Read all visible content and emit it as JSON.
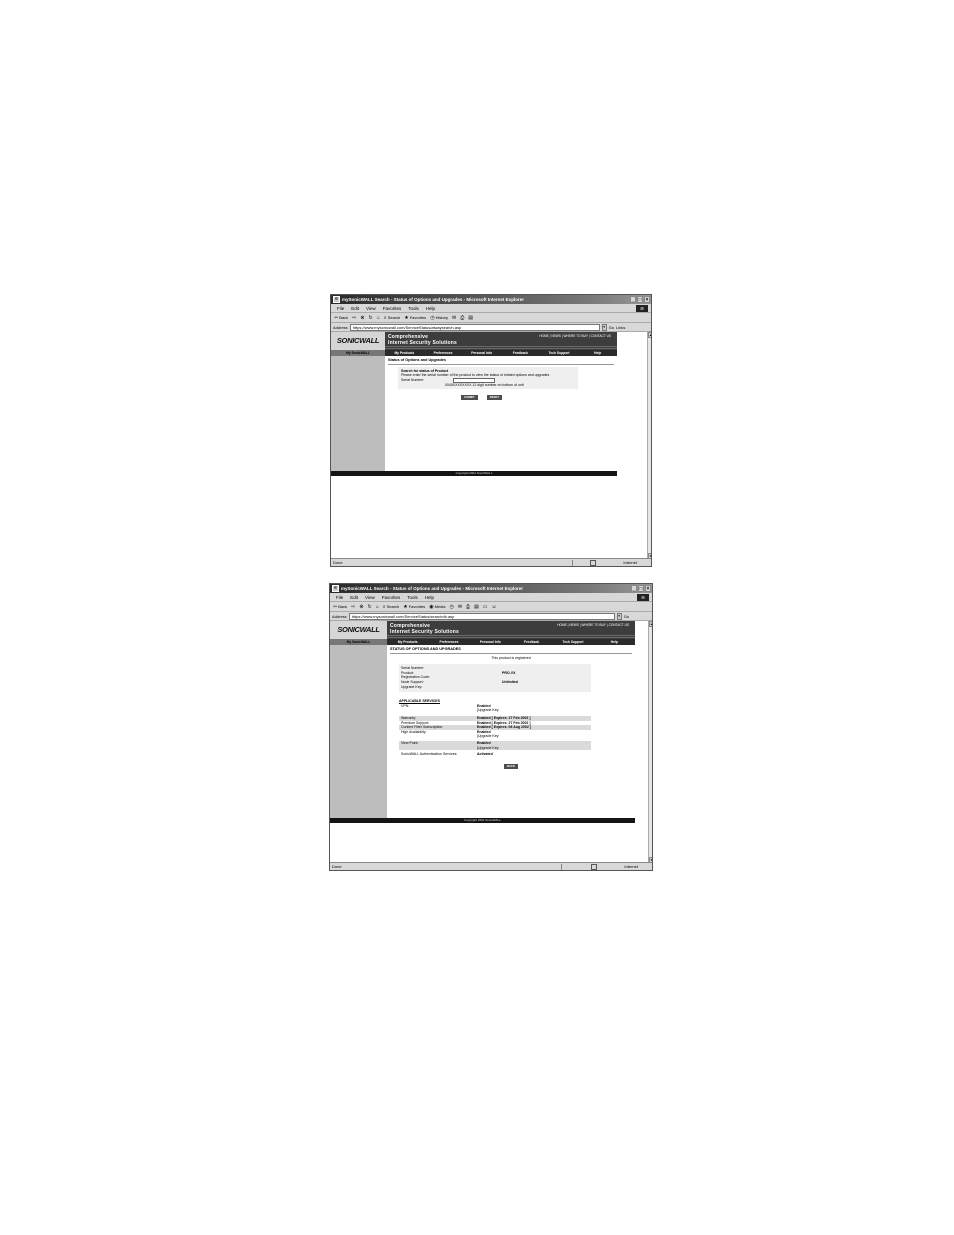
{
  "windows": [
    {
      "title": "mySonicWALL Search - Status of Options and Upgrades - Microsoft Internet Explorer",
      "menu": [
        "File",
        "Edit",
        "View",
        "Favorites",
        "Tools",
        "Help"
      ],
      "toolbar": {
        "back": "Back",
        "search": "Search",
        "favorites": "Favorites",
        "history": "History"
      },
      "address_label": "Address",
      "url": "https://www.mysonicwall.com/ServiceStatus/alwaysearch.asp",
      "go": "Go",
      "links": "Links",
      "status": "Done",
      "zone": "Internet",
      "site": {
        "logo": "SONICWALL",
        "tagline_1": "Comprehensive",
        "tagline_2": "Internet Security Solutions",
        "top_links": "HOME | NEWS | WHERE TO BUY | CONTACT US",
        "nav": [
          "My SonicWALL",
          "My Products",
          "Preferences",
          "Personal Info",
          "Feedback",
          "Tech Support",
          "Help"
        ],
        "page_title": "Status of Options and Upgrades",
        "form_title": "Search for status of Product",
        "form_text": "Please enter the serial number of the product to view the status of related options and upgrades",
        "serial_label": "Serial Number:",
        "serial_hint": "0040XXXXXXXX 12 digit number on bottom of unit",
        "submit": "SUBMIT",
        "reset": "RESET",
        "copyright": "Copyright 2001 SonicWALL"
      }
    },
    {
      "title": "mySonicWALL Search - Status of Options and Upgrades - Microsoft Internet Explorer",
      "menu": [
        "File",
        "Edit",
        "View",
        "Favorites",
        "Tools",
        "Help"
      ],
      "toolbar": {
        "back": "Back",
        "search": "Search",
        "favorites": "Favorites",
        "media": "Media"
      },
      "address_label": "Address",
      "url": "https://www.mysonicwall.com/ServiceStatus/searchdb.asp",
      "go": "Go",
      "status": "Done",
      "zone": "Internet",
      "site": {
        "logo": "SONICWALL",
        "tagline_1": "Comprehensive",
        "tagline_2": "Internet Security Solutions",
        "top_links": "HOME | NEWS | WHERE TO BUY | CONTACT US",
        "nav": [
          "My SonicWALL",
          "My Products",
          "Preferences",
          "Personal Info",
          "Feedback",
          "Tech Support",
          "Help"
        ],
        "page_title": "STATUS OF OPTIONS AND UPGRADES",
        "registered": "This product is registered",
        "product_info": [
          {
            "label": "Serial Number:",
            "value": ""
          },
          {
            "label": "Product:",
            "value": "PRO-VX"
          },
          {
            "label": "Registration Code:",
            "value": ""
          },
          {
            "label": "Node Support:",
            "value": "Unlimited"
          },
          {
            "label": "Upgrade Key:",
            "value": ""
          }
        ],
        "services_title": "APPLICABLE SERVICES",
        "services": [
          {
            "label": "VPN:",
            "status": "Enabled",
            "detail": "",
            "line2": "[Upgrade Key:"
          },
          {
            "label": "Warranty:",
            "status": "Enabled",
            "detail": "[ Expires: 27 Feb 2002 ]",
            "line2": ""
          },
          {
            "label": "Premium Support:",
            "status": "Enabled",
            "detail": "[ Expires: 27 Feb 2002 ]",
            "line2": ""
          },
          {
            "label": "Content Filter Subscription:",
            "status": "Enabled",
            "detail": "[ Expires: 06 Aug 2002 ]",
            "line2": ""
          },
          {
            "label": "High Availability:",
            "status": "Enabled",
            "detail": "",
            "line2": "[Upgrade Key:"
          },
          {
            "label": "View Point:",
            "status": "Enabled",
            "detail": "",
            "line2": "[Upgrade Key:"
          },
          {
            "label": "SonicWALL Authentication Services:",
            "status": "Activated",
            "detail": "",
            "line2": ""
          }
        ],
        "back": "BACK",
        "copyright": "Copyright 2001 SonicWALL"
      }
    }
  ]
}
